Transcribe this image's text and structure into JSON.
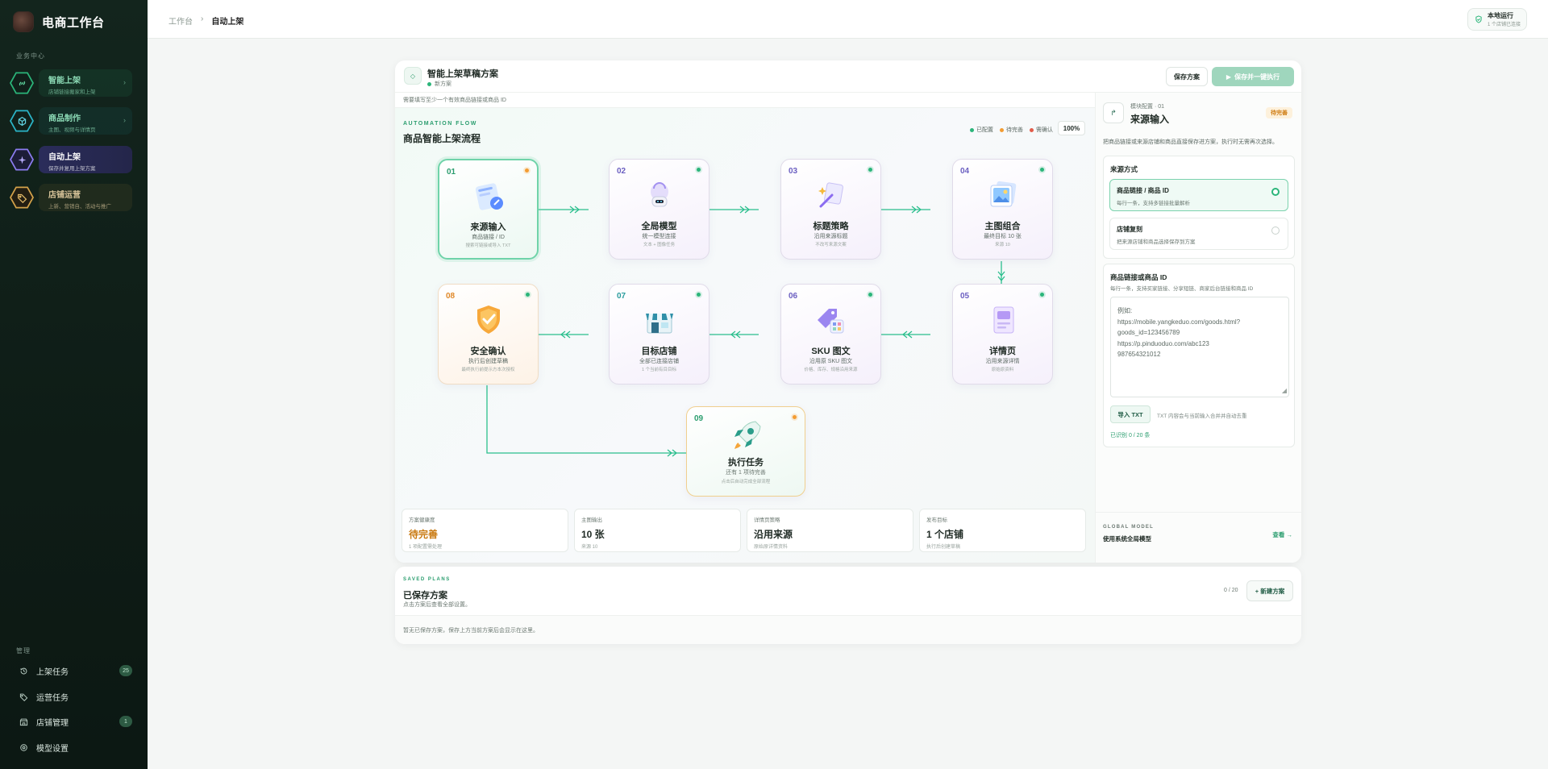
{
  "brand": {
    "title": "电商工作台"
  },
  "sidebar": {
    "section_business": "业务中心",
    "items": [
      {
        "label": "智能上架",
        "sub": "店铺链接搬家和上架",
        "color": "#2bb57a"
      },
      {
        "label": "商品制作",
        "sub": "主图、视频与详情页",
        "color": "#2bb5c8"
      },
      {
        "label": "自动上架",
        "sub": "保存并复用上架方案",
        "color": "#8b7cf0"
      },
      {
        "label": "店铺运营",
        "sub": "上新、营销自、活动与推广",
        "color": "#d4a24a"
      }
    ],
    "section_manage": "管理",
    "bottom": [
      {
        "label": "上架任务",
        "badge": "25"
      },
      {
        "label": "运营任务",
        "badge": ""
      },
      {
        "label": "店铺管理",
        "badge": "1"
      },
      {
        "label": "模型设置",
        "badge": ""
      }
    ]
  },
  "topbar": {
    "crumb_root": "工作台",
    "crumb_sep": "›",
    "crumb_current": "自动上架",
    "status_title": "本地运行",
    "status_sub": "1 个店铺已连接"
  },
  "plan": {
    "title": "智能上架草稿方案",
    "status": "新方案",
    "save_label": "保存方案",
    "run_label": "保存并一键执行",
    "warning": "需要填写至少一个有效商品链接或商品 ID"
  },
  "flow": {
    "label": "AUTOMATION FLOW",
    "title": "商品智能上架流程",
    "legend": [
      "已配置",
      "待完善",
      "需确认"
    ],
    "zoom": "100%",
    "nodes": [
      {
        "num": "01",
        "title": "来源输入",
        "sub": "商品链接 / ID",
        "meta": "搜索可链接或导入 TXT"
      },
      {
        "num": "02",
        "title": "全局模型",
        "sub": "统一模型连接",
        "meta": "文本 + 图像任务"
      },
      {
        "num": "03",
        "title": "标题策略",
        "sub": "沿用来源标题",
        "meta": "不改写来源文案"
      },
      {
        "num": "04",
        "title": "主图组合",
        "sub": "最终目标 10 张",
        "meta": "来源 10"
      },
      {
        "num": "05",
        "title": "详情页",
        "sub": "沿用来源详情",
        "meta": "原始原资料"
      },
      {
        "num": "06",
        "title": "SKU 图文",
        "sub": "沿用原 SKU 图文",
        "meta": "价格、库存、规格沿用来源"
      },
      {
        "num": "07",
        "title": "目标店铺",
        "sub": "全部已连接店铺",
        "meta": "1 个当前有目目标"
      },
      {
        "num": "08",
        "title": "安全确认",
        "sub": "执行后创建草稿",
        "meta": "最终执行前提示方本次授权"
      },
      {
        "num": "09",
        "title": "执行任务",
        "sub": "还有 1 项待完善",
        "meta": "点击后自动完成全部流程"
      }
    ]
  },
  "stats": [
    {
      "key": "方案健康度",
      "value": "待完善",
      "hint": "1 项配置需处理"
    },
    {
      "key": "主图输出",
      "value": "10 张",
      "hint": "来源 10"
    },
    {
      "key": "详情页策略",
      "value": "沿用来源",
      "hint": "原始原详情资料"
    },
    {
      "key": "发布目标",
      "value": "1 个店铺",
      "hint": "执行后创建草稿"
    }
  ],
  "panel": {
    "kicker": "模块配置 · 01",
    "title": "来源输入",
    "pending": "待完善",
    "desc": "把商品链接或来源店铺和商品直接保存进方案，执行时无需再次选择。",
    "source_title": "来源方式",
    "options": [
      {
        "title": "商品链接 / 商品 ID",
        "sub": "每行一条，支持多链接批量解析"
      },
      {
        "title": "店铺复刻",
        "sub": "把来源店铺和商品选择保存到方案"
      }
    ],
    "links_title": "商品链接或商品 ID",
    "links_sub": "每行一条，支持买家链接、分享短链、商家后台链接和商品 ID",
    "placeholder_lines": [
      "例如:",
      "https://mobile.yangkeduo.com/goods.html?",
      "goods_id=123456789",
      "https://p.pinduoduo.com/abc123",
      "987654321012"
    ],
    "import_label": "导入 TXT",
    "import_hint": "TXT 内容会与当前输入合并并自动去重",
    "recognized": "已识别 0 / 20 条",
    "global_label": "GLOBAL MODEL",
    "global_value": "使用系统全局模型",
    "global_link": "查看 →"
  },
  "saved": {
    "kicker": "SAVED PLANS",
    "title": "已保存方案",
    "sub": "点击方案后查看全部设置。",
    "count": "0 / 20",
    "new_label": "+ 新建方案",
    "empty": "暂无已保存方案，保存上方当前方案后会显示在这里。"
  },
  "colors": {
    "accent": "#2bb57a",
    "pending": "#f39c32",
    "confirm": "#e25c4a"
  }
}
